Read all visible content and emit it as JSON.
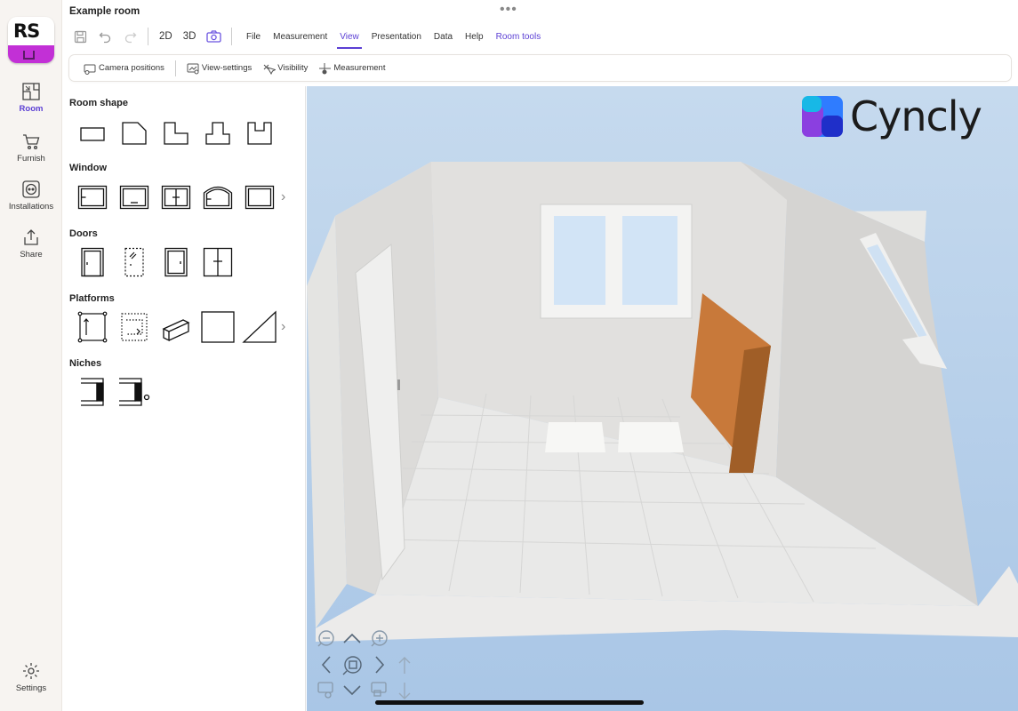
{
  "app": {
    "title": "Example room",
    "logo_text": "RS"
  },
  "rail": {
    "items": [
      {
        "label": "Room",
        "icon": "room-plan-icon",
        "active": true
      },
      {
        "label": "Furnish",
        "icon": "cart-icon",
        "active": false
      },
      {
        "label": "Installations",
        "icon": "power-outlet-icon",
        "active": false
      },
      {
        "label": "Share",
        "icon": "share-icon",
        "active": false
      }
    ],
    "settings_label": "Settings"
  },
  "toolbar": {
    "view_2d": "2D",
    "view_3d": "3D"
  },
  "menu": {
    "items": [
      "File",
      "Measurement",
      "View",
      "Presentation",
      "Data",
      "Help",
      "Room tools"
    ],
    "active": "View"
  },
  "subbar": {
    "items": [
      "Camera positions",
      "View-settings",
      "Visibility",
      "Measurement"
    ]
  },
  "panel": {
    "sections": [
      {
        "title": "Room shape"
      },
      {
        "title": "Window"
      },
      {
        "title": "Doors"
      },
      {
        "title": "Platforms"
      },
      {
        "title": "Niches"
      }
    ]
  },
  "brand": {
    "name": "Cyncly"
  },
  "colors": {
    "accent": "#5b3fd4",
    "logo_magenta": "#c230d6",
    "sky": "#b4cfea",
    "orange_box": "#c8793a"
  }
}
